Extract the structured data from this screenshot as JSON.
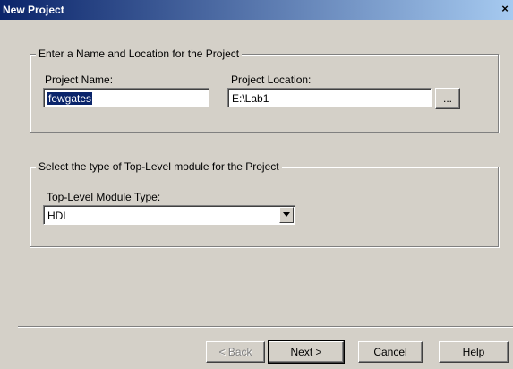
{
  "window": {
    "title": "New Project",
    "close_glyph": "×"
  },
  "group_name_location": {
    "legend": "Enter a Name and Location for the Project",
    "project_name_label": "Project Name:",
    "project_name_value": "fewgates",
    "project_location_label": "Project Location:",
    "project_location_value": "E:\\Lab1",
    "browse_label": "..."
  },
  "group_module_type": {
    "legend": "Select the type of Top-Level module for the Project",
    "module_type_label": "Top-Level Module Type:",
    "module_type_value": "HDL"
  },
  "buttons": {
    "back_label": "< Back",
    "next_label": "Next >",
    "cancel_label": "Cancel",
    "help_label": "Help"
  }
}
